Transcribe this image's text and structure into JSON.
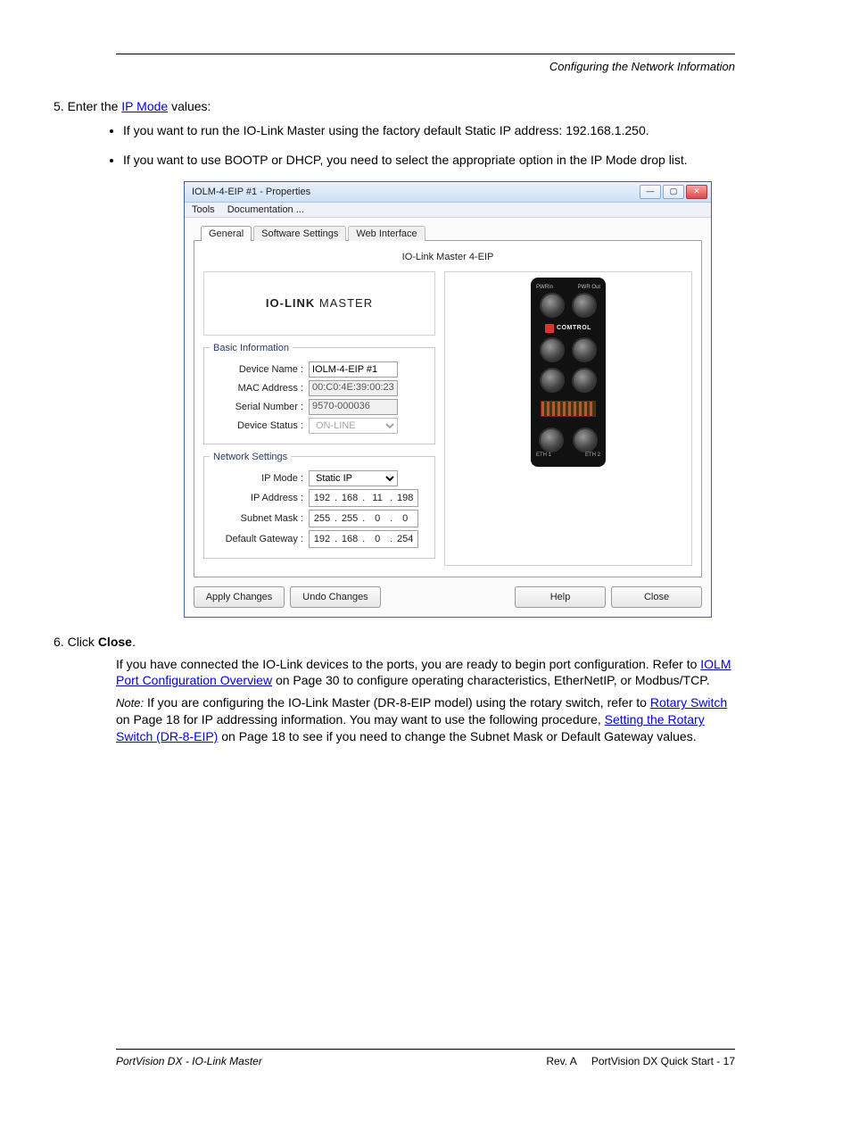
{
  "header_right": "Configuring the Network Information",
  "instruct_line": "Enter the",
  "instruct_link": "IP Mode",
  "instruct_rest": "values:",
  "bullets": [
    "If you want to run the IO-Link Master using the factory default Static IP address: 192.168.1.250.",
    "If you want to use BOOTP or DHCP, you need to select the appropriate option in the IP Mode drop list."
  ],
  "window_title": "IOLM-4-EIP #1 - Properties",
  "menu": {
    "tools": "Tools",
    "documentation": "Documentation ..."
  },
  "tabs": {
    "general": "General",
    "software": "Software Settings",
    "web": "Web Interface"
  },
  "tab_title": "IO-Link Master 4-EIP",
  "logo_bold": "IO-LINK",
  "logo_rest": " MASTER",
  "basic_legend": "Basic Information",
  "basic": {
    "device_name_label": "Device Name :",
    "device_name_value": "IOLM-4-EIP #1",
    "mac_label": "MAC Address :",
    "mac_value": "00:C0:4E:39:00:23",
    "serial_label": "Serial Number :",
    "serial_value": "9570-000036",
    "status_label": "Device Status :",
    "status_value": "ON-LINE"
  },
  "net_legend": "Network Settings",
  "net": {
    "ipmode_label": "IP Mode :",
    "ipmode_value": "Static IP",
    "ipaddr_label": "IP Address :",
    "ipaddr": [
      "192",
      "168",
      "11",
      "198"
    ],
    "subnet_label": "Subnet Mask :",
    "subnet": [
      "255",
      "255",
      "0",
      "0"
    ],
    "gateway_label": "Default Gateway :",
    "gateway": [
      "192",
      "168",
      "0",
      "254"
    ]
  },
  "buttons": {
    "apply": "Apply Changes",
    "undo": "Undo Changes",
    "help": "Help",
    "close": "Close"
  },
  "device_labels": {
    "top1": "PWRIn",
    "top2": "PWR Out",
    "eth1": "ETH 1",
    "eth2": "ETH 2",
    "brand": "COMTROL"
  },
  "after_window_1_a": "Click ",
  "after_window_1_b": "Close",
  "after_window_1_c": ".",
  "after_window_2": "If you have connected the IO-Link devices to the ports, you are ready to begin port configuration. Refer to ",
  "after_window_2_link": "IOLM Port Configuration Overview",
  "after_window_2_rest": " on Page 30 to configure operating characteristics, EtherNetIP, or Modbus/TCP.",
  "note_head": "Note:",
  "note_body_a": " If you are configuring the IO-Link Master (DR-8-EIP model) using the rotary switch, refer to ",
  "note_body_link": "Rotary Switch",
  "note_body_b": " on Page 18 for IP addressing information. You may want to use the following procedure, ",
  "note_body_link2": "Setting the Rotary Switch (DR-8-EIP)",
  "note_body_c": " on Page 18 to see if you need to change the Subnet Mask or Default Gateway values.",
  "footer": {
    "left": "PortVision DX - IO-Link Master",
    "right_a": "Rev. A",
    "right_b": "PortVision DX Quick Start - 17"
  }
}
